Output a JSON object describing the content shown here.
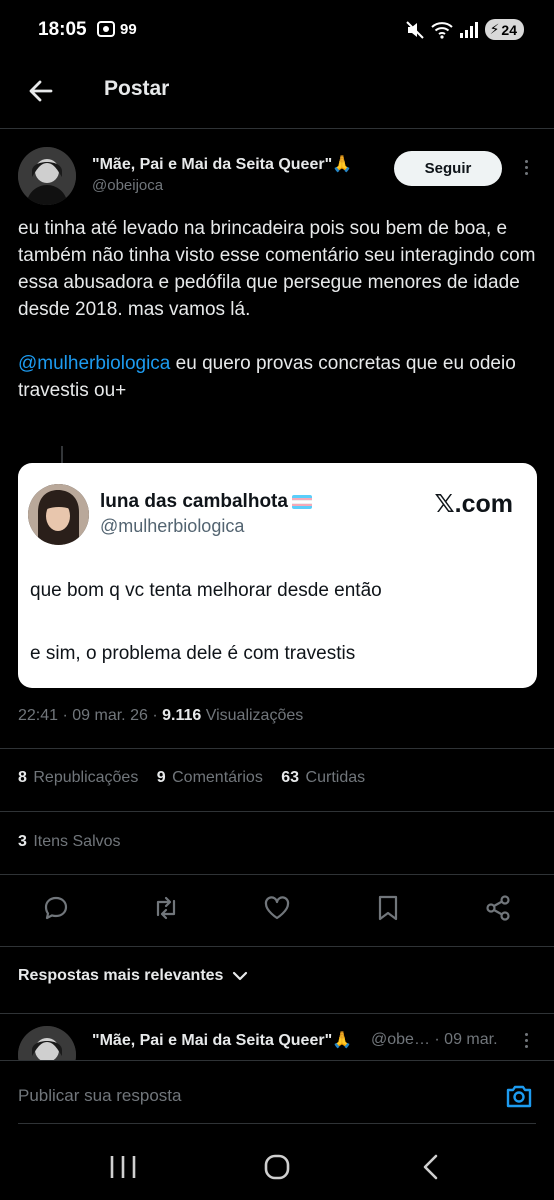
{
  "status_bar": {
    "time": "18:05",
    "notif_badge": "99",
    "battery": "24",
    "signal_label": "5"
  },
  "header": {
    "title": "Postar"
  },
  "post": {
    "author_name": "\"Mãe, Pai e Mai da Seita Queer\"🙏",
    "author_handle": "@obeijoca",
    "follow_label": "Seguir",
    "paragraph1": "eu tinha até levado na brincadeira pois sou bem de boa, e também não tinha visto esse comentário seu interagindo com essa abusadora e pedófila que persegue menores de idade desde 2018. mas vamos lá.",
    "mention": "@mulherbiologica",
    "paragraph2_rest": " eu quero provas concretas que eu odeio travestis ou+"
  },
  "quote": {
    "name": "luna das cambalhota",
    "handle": "@mulherbiologica",
    "brand": "𝕏.com",
    "line1": "que bom q vc tenta melhorar desde então",
    "line2": "e sim, o problema dele é com travestis"
  },
  "meta": {
    "time": "22:41",
    "date": "09 mar. 26",
    "views_count": "9.116",
    "views_label": "Visualizações"
  },
  "stats": {
    "reposts_count": "8",
    "reposts_label": "Republicações",
    "comments_count": "9",
    "comments_label": "Comentários",
    "likes_count": "63",
    "likes_label": "Curtidas",
    "saved_count": "3",
    "saved_label": "Itens Salvos"
  },
  "replies": {
    "sort_label": "Respostas mais relevantes",
    "first_reply_name": "\"Mãe, Pai e Mai da Seita Queer\"🙏",
    "first_reply_handle": "@obe…",
    "first_reply_date": "· 09 mar."
  },
  "compose": {
    "placeholder": "Publicar sua resposta"
  },
  "colors": {
    "background": "#000000",
    "accent": "#1d9bf0",
    "secondary_text": "#71767b",
    "flag_blue": "#5bcefa",
    "flag_pink": "#f5a9b8"
  },
  "icons": [
    "back-arrow-icon",
    "more-icon",
    "reply-icon",
    "repost-icon",
    "like-icon",
    "bookmark-icon",
    "share-icon",
    "chevron-down-icon",
    "camera-icon",
    "recents-icon",
    "home-icon",
    "back-icon"
  ]
}
